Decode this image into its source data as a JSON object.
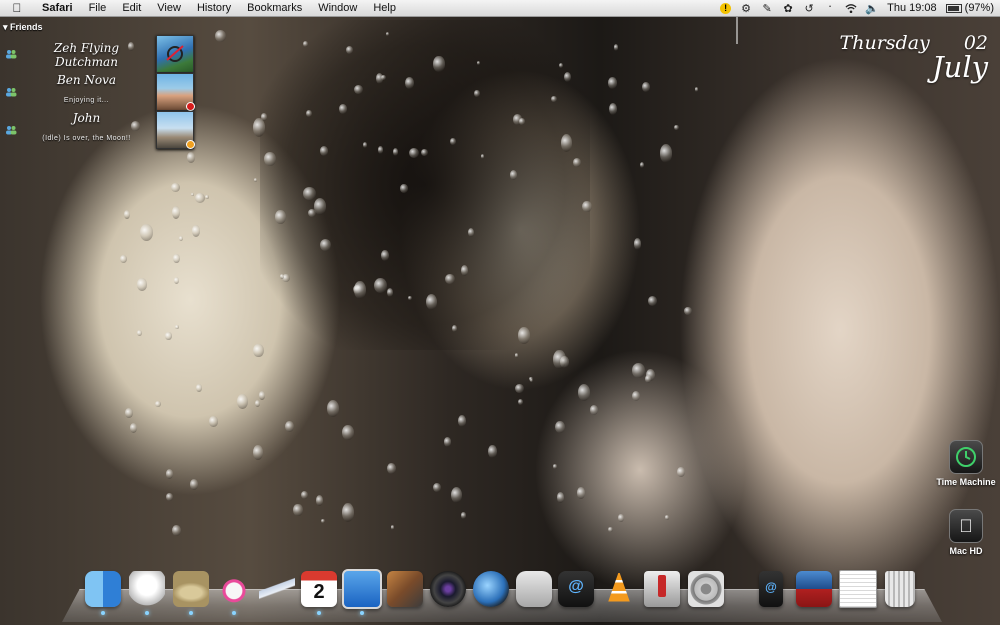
{
  "menubar": {
    "apple_icon": "apple-logo-icon",
    "app_name": "Safari",
    "menus": [
      "File",
      "Edit",
      "View",
      "History",
      "Bookmarks",
      "Window",
      "Help"
    ],
    "status": {
      "clock": "Thu 19:08",
      "battery_percent": "(97%)",
      "icons": [
        "warning-icon",
        "sync-icon",
        "script-icon",
        "paw-icon",
        "time-machine-icon",
        "bluetooth-icon",
        "wifi-icon",
        "volume-icon"
      ]
    }
  },
  "friends_widget": {
    "title": "Friends",
    "friends": [
      {
        "name": "Zeh Flying Dutchman",
        "status": ""
      },
      {
        "name": "Ben Nova",
        "status": "Enjoying it..."
      },
      {
        "name": "John",
        "status": "(Idle) Is over, the Moon!!"
      }
    ]
  },
  "date_widget": {
    "weekday": "Thursday",
    "day": "02",
    "month": "July"
  },
  "desktop_icons": [
    {
      "label": "Time Machine"
    },
    {
      "label": "Mac HD"
    }
  ],
  "dock": {
    "items": [
      "finder-icon",
      "cyberduck-icon",
      "safari-explorer-icon",
      "headphones-icon",
      "plane-icon",
      "ical-icon",
      "screen-sharing-icon",
      "iphoto-icon",
      "camera-lens-icon",
      "quicktime-icon",
      "preview-icon",
      "mail-icon",
      "vlc-icon",
      "terminal-icon",
      "system-preferences-icon",
      "ipod-mail-icon",
      "photos-folder-icon",
      "documents-stack-icon",
      "trash-icon"
    ],
    "calendar_date": "2"
  },
  "colors": {
    "accent_blue": "#1a78d8",
    "badge_red": "#d71c1c",
    "menubar": "#e6e6e6"
  }
}
